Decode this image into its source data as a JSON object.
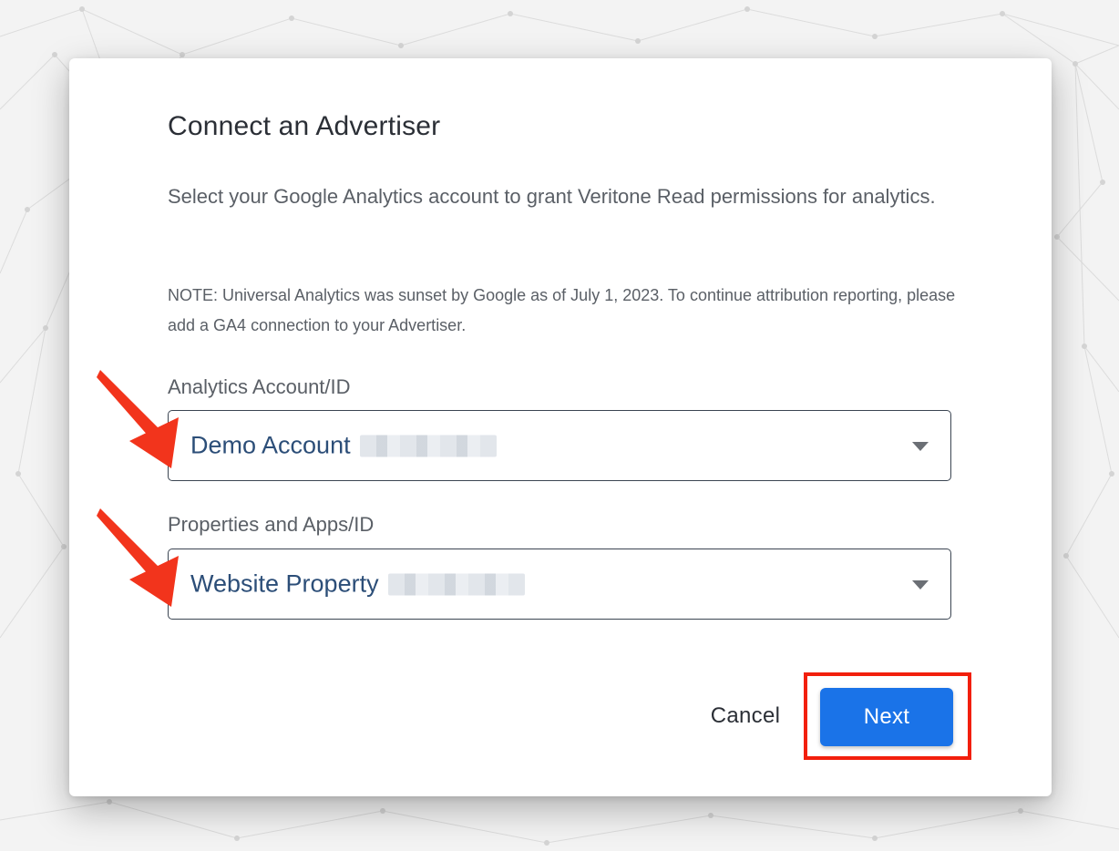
{
  "dialog": {
    "title": "Connect an Advertiser",
    "description": "Select your Google Analytics account to grant Veritone Read permissions for analytics.",
    "note": "NOTE: Universal Analytics was sunset by Google as of July 1, 2023. To continue attribution reporting, please add a GA4 connection to your Advertiser."
  },
  "fields": {
    "account": {
      "label": "Analytics Account/ID",
      "value": "Demo Account"
    },
    "property": {
      "label": "Properties and Apps/ID",
      "value": "Website Property"
    }
  },
  "actions": {
    "cancel_label": "Cancel",
    "next_label": "Next"
  },
  "colors": {
    "primary_button": "#1a73e8",
    "annotation": "#f21f0c",
    "select_value_text": "#2c4e78"
  },
  "annotations": {
    "arrows": [
      "arrow-to-account-select",
      "arrow-to-property-select"
    ],
    "highlight": "next-button-highlight"
  }
}
